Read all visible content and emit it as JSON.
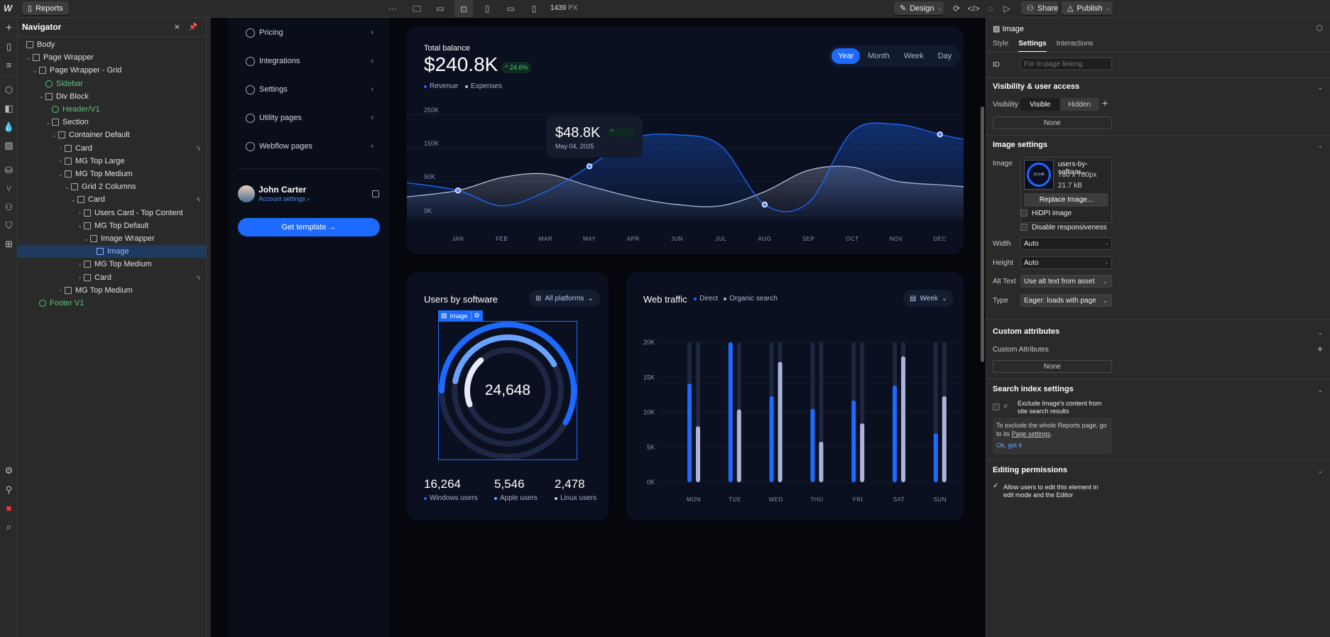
{
  "topbar": {
    "page": "Reports",
    "more": "···",
    "width_value": "1439",
    "width_unit": "PX",
    "design": "Design",
    "share": "Share",
    "publish": "Publish"
  },
  "navigator": {
    "title": "Navigator",
    "items": [
      {
        "label": "Body",
        "level": 0,
        "type": "body"
      },
      {
        "label": "Page Wrapper",
        "level": 1,
        "open": true
      },
      {
        "label": "Page Wrapper - Grid",
        "level": 2,
        "open": true
      },
      {
        "label": "Sidebar",
        "level": 3,
        "type": "component"
      },
      {
        "label": "Div Block",
        "level": 3,
        "open": true
      },
      {
        "label": "Header/V1",
        "level": 4,
        "type": "component"
      },
      {
        "label": "Section",
        "level": 4,
        "open": true
      },
      {
        "label": "Container Default",
        "level": 5,
        "open": true
      },
      {
        "label": "Card",
        "level": 6,
        "open": false,
        "bolt": true
      },
      {
        "label": "MG Top Large",
        "level": 6,
        "open": false
      },
      {
        "label": "MG Top Medium",
        "level": 6,
        "open": true
      },
      {
        "label": "Grid 2 Columns",
        "level": 7,
        "open": true
      },
      {
        "label": "Card",
        "level": 8,
        "open": true,
        "bolt": true
      },
      {
        "label": "Users Card - Top Content",
        "level": 9,
        "open": false
      },
      {
        "label": "MG Top Default",
        "level": 9,
        "open": true
      },
      {
        "label": "Image Wrapper",
        "level": 10,
        "open": true
      },
      {
        "label": "Image",
        "level": 11,
        "type": "image",
        "selected": true
      },
      {
        "label": "MG Top Medium",
        "level": 9,
        "open": false
      },
      {
        "label": "Card",
        "level": 9,
        "open": false,
        "bolt": true
      },
      {
        "label": "MG Top Medium",
        "level": 6,
        "open": false
      },
      {
        "label": "Footer V1",
        "level": 2,
        "type": "component"
      }
    ]
  },
  "sidebar": {
    "items": [
      {
        "label": "Pricing",
        "icon": "dollar-icon"
      },
      {
        "label": "Integrations",
        "icon": "puzzle-icon"
      },
      {
        "label": "Settings",
        "icon": "gear-icon"
      },
      {
        "label": "Utility pages",
        "icon": "wrench-icon"
      },
      {
        "label": "Webflow pages",
        "icon": "webflow-icon"
      }
    ],
    "user": {
      "name": "John Carter",
      "link": "Account settings ›"
    },
    "cta": "Get template →"
  },
  "balance": {
    "title": "Total balance",
    "value": "$240.8K",
    "change": "24.6%",
    "legend": [
      "Revenue",
      "Expenses"
    ],
    "periods": [
      "Year",
      "Month",
      "Week",
      "Day"
    ],
    "active_period": "Year",
    "tooltip": {
      "value": "$48.8K",
      "date": "May 04, 2025"
    }
  },
  "users": {
    "title": "Users by software",
    "filter": "All platforms",
    "total": "24,648",
    "image_label": "Image",
    "stats": [
      {
        "value": "16,264",
        "label": "Windows users",
        "color": "#1d6aff"
      },
      {
        "value": "5,546",
        "label": "Apple users",
        "color": "#6aa3ff"
      },
      {
        "value": "2,478",
        "label": "Linux users",
        "color": "#c8cde0"
      }
    ],
    "rings": [
      {
        "fraction": 0.58,
        "color": "#1d6aff"
      },
      {
        "fraction": 0.39,
        "color": "#6aa3ff"
      },
      {
        "fraction": 0.19,
        "color": "#e8ecf8"
      }
    ]
  },
  "traffic": {
    "title": "Web traffic",
    "legend": [
      "Direct",
      "Organic search"
    ],
    "period": "Week"
  },
  "chart_data": [
    {
      "type": "area",
      "title": "Total balance",
      "categories": [
        "JAN",
        "FEB",
        "MAR",
        "MAY",
        "APR",
        "JUN",
        "JUL",
        "AUG",
        "SEP",
        "OCT",
        "NOV",
        "DEC"
      ],
      "yticks": [
        "250K",
        "150K",
        "50K",
        "0K"
      ],
      "ylim": [
        0,
        250
      ],
      "series": [
        {
          "name": "Revenue",
          "color": "#1d6aff",
          "values": [
            56,
            18,
            53,
            116,
            185,
            194,
            167,
            21,
            26,
            202,
            220,
            195
          ],
          "markers": [
            "JAN",
            "MAY",
            "AUG",
            "DEC"
          ]
        },
        {
          "name": "Expenses",
          "color": "#b8c0d8",
          "values": [
            56,
            88,
            97,
            67,
            39,
            21,
            18,
            53,
            106,
            114,
            79,
            70
          ]
        }
      ]
    },
    {
      "type": "bar",
      "title": "Web traffic",
      "categories": [
        "MON",
        "TUE",
        "WED",
        "THU",
        "FRI",
        "SAT",
        "SUN"
      ],
      "yticks": [
        "20K",
        "15K",
        "10K",
        "5K",
        "0K"
      ],
      "ylim": [
        0,
        20
      ],
      "series": [
        {
          "name": "Direct",
          "color": "#1d6aff",
          "values": [
            14.1,
            20,
            12.3,
            10.5,
            11.7,
            13.8,
            7.0
          ]
        },
        {
          "name": "Organic search",
          "color": "#aab4d8",
          "values": [
            8.0,
            10.4,
            17.2,
            5.8,
            8.4,
            18.0,
            12.3
          ]
        }
      ]
    }
  ],
  "panel": {
    "element": "Image",
    "tabs": [
      "Style",
      "Settings",
      "Interactions"
    ],
    "active_tab": "Settings",
    "id_label": "ID",
    "id_placeholder": "For in-page linking",
    "visibility_title": "Visibility & user access",
    "visibility_label": "Visibility",
    "visible": "Visible",
    "hidden": "Hidden",
    "none": "None",
    "image_title": "Image settings",
    "image_label": "Image",
    "file_name": "users-by-softwar...",
    "file_dims": "780 x 780px",
    "file_size": "21.7 kB",
    "thumb_text": "24,648",
    "replace": "Replace Image...",
    "hidpi": "HiDPI image",
    "disable_resp": "Disable responsiveness",
    "width_label": "Width",
    "width": "Auto",
    "height_label": "Height",
    "height": "Auto",
    "alt_label": "Alt Text",
    "alt": "Use alt text from asset",
    "type_label": "Type",
    "type": "Eager: loads with page",
    "custom_title": "Custom attributes",
    "custom_label": "Custom Attributes",
    "custom_none": "None",
    "search_title": "Search index settings",
    "search_exclude": "Exclude Image's content from site search results",
    "search_info": "To exclude the whole Reports page, go to its",
    "search_link": "Page settings",
    "search_ok": "Ok, got it",
    "edit_title": "Editing permissions",
    "edit_allow": "Allow users to edit this element in edit mode and the Editor"
  }
}
